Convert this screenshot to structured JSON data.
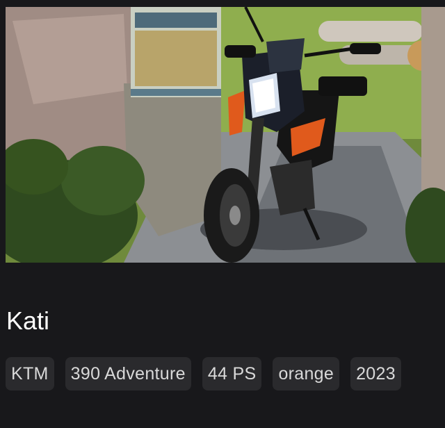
{
  "vehicle": {
    "name": "Kati",
    "tags": [
      "KTM",
      "390 Adventure",
      "44 PS",
      "orange",
      "2023"
    ]
  },
  "photo": {
    "subject": "motorcycle-photo"
  },
  "colors": {
    "background": "#18181b",
    "chip_background": "#2a2a2d",
    "chip_text": "#d9d9d9",
    "title_text": "#ffffff",
    "accent_orange": "#e05a1c"
  }
}
